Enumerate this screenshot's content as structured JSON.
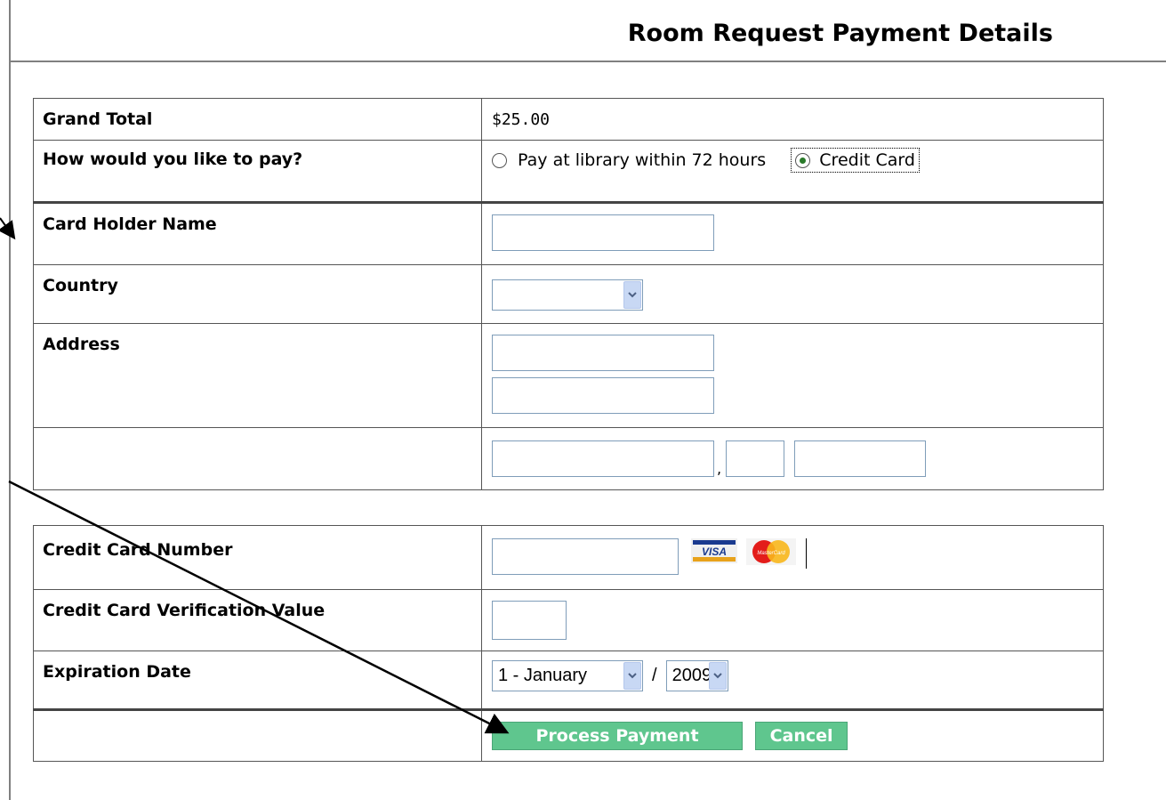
{
  "page": {
    "title": "Room Request Payment Details"
  },
  "billing": {
    "grand_total_label": "Grand Total",
    "grand_total_value": "$25.00",
    "pay_method_label": "How would you like to pay?",
    "pay_options": [
      "Pay at library within 72 hours",
      "Credit Card"
    ],
    "pay_selected": "Credit Card",
    "card_holder_label": "Card Holder Name",
    "card_holder_value": "",
    "country_label": "Country",
    "country_value": "",
    "address_label": "Address",
    "address_line1": "",
    "address_line2": "",
    "city_state_separator": ","
  },
  "card": {
    "number_label": "Credit Card Number",
    "number_value": "",
    "card_logos": [
      "VISA",
      "MasterCard"
    ],
    "cvv_label": "Credit Card Verification Value",
    "cvv_value": "",
    "expiration_label": "Expiration Date",
    "exp_month": "1 - January",
    "exp_separator": "/",
    "exp_year": "2009"
  },
  "actions": {
    "process_label": "Process Payment",
    "cancel_label": "Cancel"
  },
  "colors": {
    "button": "#5fc68e",
    "input_border": "#7f9db9",
    "arrow": "#000000"
  },
  "icons": [
    "chevron-down-icon",
    "visa-icon",
    "mastercard-icon",
    "radio-icon"
  ]
}
